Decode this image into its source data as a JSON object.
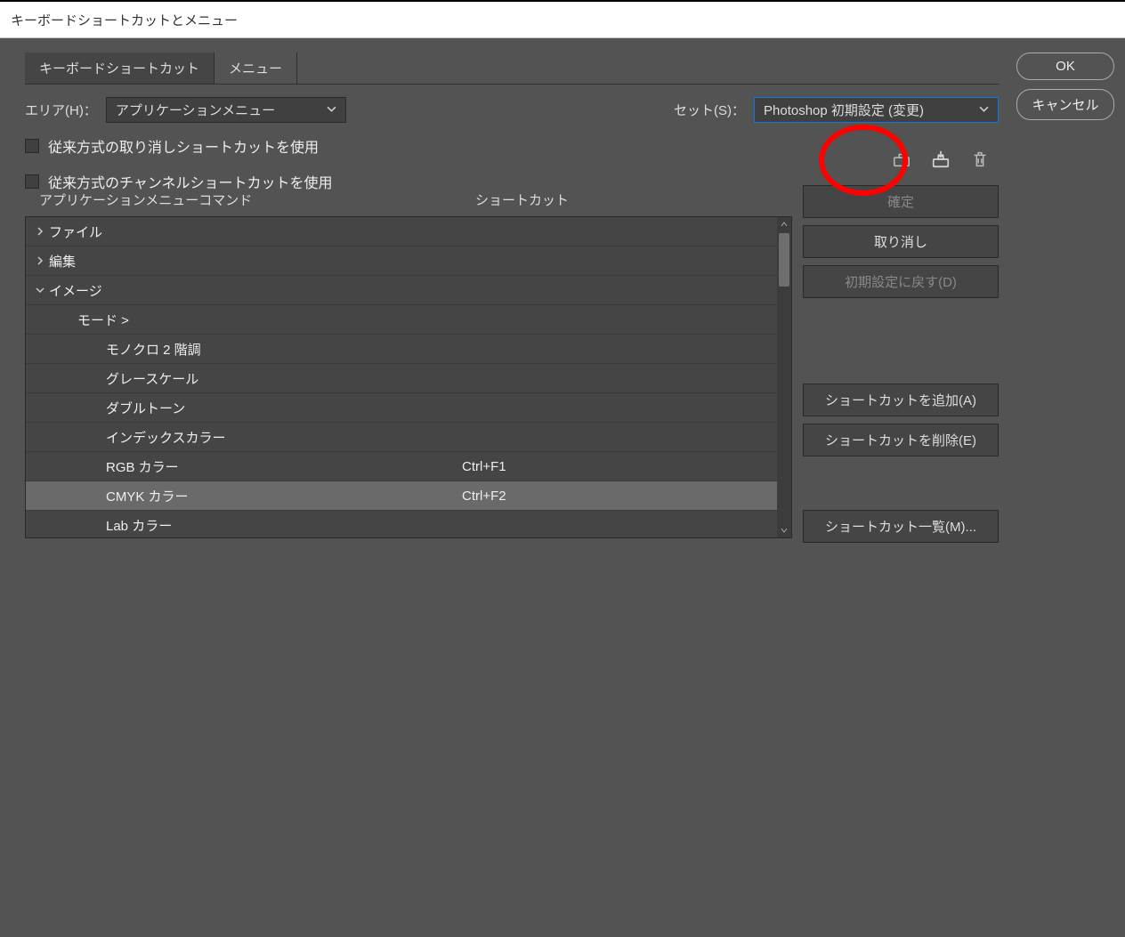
{
  "window": {
    "title": "キーボードショートカットとメニュー"
  },
  "right_buttons": {
    "ok": "OK",
    "cancel": "キャンセル"
  },
  "tabs": {
    "shortcuts": "キーボードショートカット",
    "menus": "メニュー"
  },
  "area": {
    "label": "エリア(H)：",
    "value": "アプリケーションメニュー"
  },
  "set": {
    "label": "セット(S)：",
    "value": "Photoshop 初期設定 (変更)"
  },
  "checks": {
    "legacy_undo": "従来方式の取り消しショートカットを使用",
    "legacy_channel": "従来方式のチャンネルショートカットを使用"
  },
  "icons": {
    "new_set": "new-set-icon",
    "save_set": "save-set-icon",
    "delete_set": "trash-icon"
  },
  "headers": {
    "cmd": "アプリケーションメニューコマンド",
    "sc": "ショートカット"
  },
  "tree": [
    {
      "indent": 0,
      "twisty": "right",
      "label": "ファイル",
      "sc": ""
    },
    {
      "indent": 0,
      "twisty": "right",
      "label": "編集",
      "sc": ""
    },
    {
      "indent": 0,
      "twisty": "down",
      "label": "イメージ",
      "sc": ""
    },
    {
      "indent": 1,
      "twisty": "",
      "label": "モード >",
      "sc": ""
    },
    {
      "indent": 2,
      "twisty": "",
      "label": "モノクロ 2 階調",
      "sc": ""
    },
    {
      "indent": 2,
      "twisty": "",
      "label": "グレースケール",
      "sc": ""
    },
    {
      "indent": 2,
      "twisty": "",
      "label": "ダブルトーン",
      "sc": ""
    },
    {
      "indent": 2,
      "twisty": "",
      "label": "インデックスカラー",
      "sc": ""
    },
    {
      "indent": 2,
      "twisty": "",
      "label": "RGB カラー",
      "sc": "Ctrl+F1"
    },
    {
      "indent": 2,
      "twisty": "",
      "label": "CMYK カラー",
      "sc": "Ctrl+F2",
      "selected": true
    },
    {
      "indent": 2,
      "twisty": "",
      "label": "Lab カラー",
      "sc": ""
    }
  ],
  "actions": {
    "accept": "確定",
    "undo": "取り消し",
    "default": "初期設定に戻す(D)",
    "add": "ショートカットを追加(A)",
    "delete": "ショートカットを削除(E)",
    "summary": "ショートカット一覧(M)..."
  }
}
